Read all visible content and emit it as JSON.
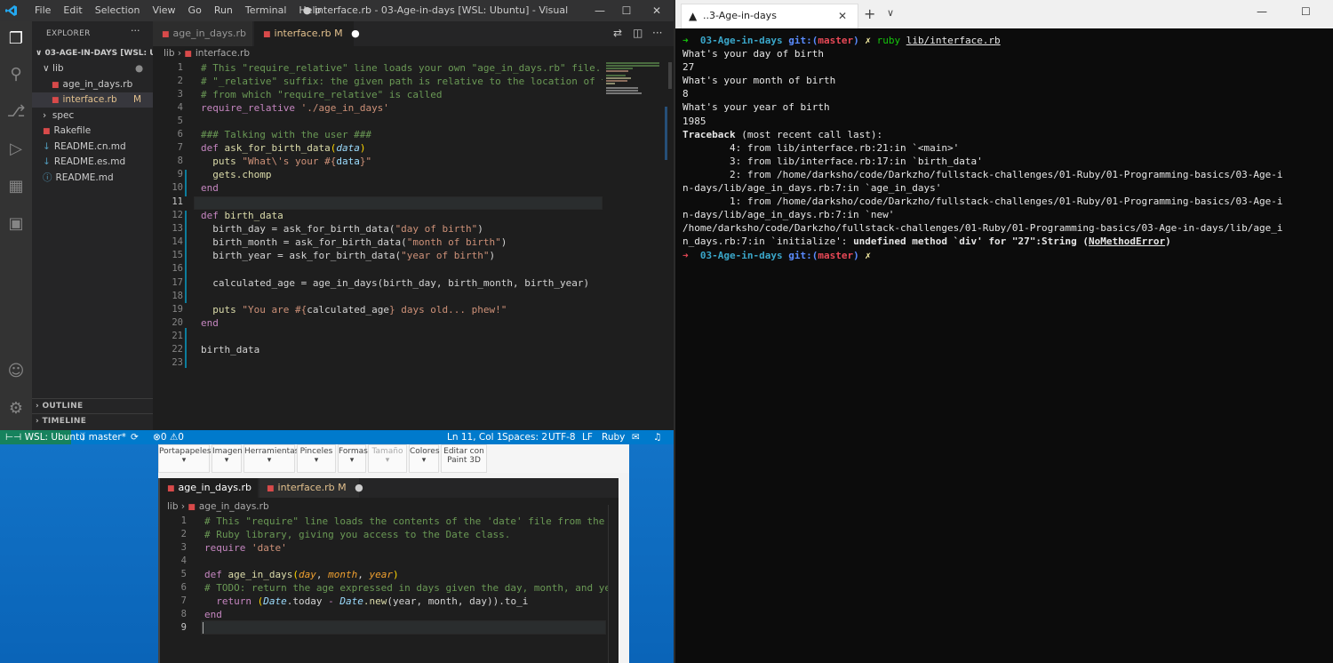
{
  "vscode": {
    "menu": [
      "File",
      "Edit",
      "Selection",
      "View",
      "Go",
      "Run",
      "Terminal",
      "Help"
    ],
    "window_title": "● interface.rb - 03-Age-in-days [WSL: Ubuntu] - Visual Studio Code",
    "explorer": {
      "header": "EXPLORER",
      "root": "03-AGE-IN-DAYS [WSL: UB...",
      "lib": "lib",
      "files_lib": [
        {
          "name": "age_in_days.rb"
        },
        {
          "name": "interface.rb",
          "badge": "M"
        }
      ],
      "spec": "spec",
      "root_files": [
        "Rakefile",
        "README.cn.md",
        "README.es.md",
        "README.md"
      ],
      "outline": "OUTLINE",
      "timeline": "TIMELINE"
    },
    "tabs": [
      {
        "label": "age_in_days.rb"
      },
      {
        "label": "interface.rb",
        "badge": "M"
      }
    ],
    "breadcrumb": {
      "folder": "lib",
      "file": "interface.rb"
    },
    "line_numbers": [
      "1",
      "2",
      "3",
      "4",
      "5",
      "6",
      "7",
      "8",
      "9",
      "10",
      "11",
      "12",
      "13",
      "14",
      "15",
      "16",
      "17",
      "18",
      "19",
      "20",
      "21",
      "22",
      "23"
    ],
    "status": {
      "remote": "WSL: Ubuntu",
      "branch": "master*",
      "problems": "0",
      "warnings": "0",
      "position": "Ln 11, Col 1",
      "spaces": "Spaces: 2",
      "encoding": "UTF-8",
      "eol": "LF",
      "language": "Ruby"
    }
  },
  "code_main": {
    "l1": "# This \"require_relative\" line loads your own \"age_in_days.rb\" file. Notice",
    "l2": "# \"_relative\" suffix: the given path is relative to the location of the fi",
    "l3": "# from which \"require_relative\" is called",
    "l4a": "require_relative",
    "l4b": "'./age_in_days'",
    "l6": "### Talking with the user ###",
    "l7a": "def",
    "l7b": "ask_for_birth_data",
    "l7c": "data",
    "l8a": "puts",
    "l8b": "\"What\\'s your #{",
    "l8c": "data",
    "l8d": "}\"",
    "l9": "gets.chomp",
    "l10": "end",
    "l12a": "def",
    "l12b": "birth_data",
    "l13a": "birth_day = ask_for_birth_data(",
    "l13b": "\"day of birth\"",
    "l14a": "birth_month = ask_for_birth_data(",
    "l14b": "\"month of birth\"",
    "l15a": "birth_year = ask_for_birth_data(",
    "l15b": "\"year of birth\"",
    "l17": "calculated_age = age_in_days(birth_day, birth_month, birth_year)",
    "l19a": "puts",
    "l19b": "\"You are #{",
    "l19c": "calculated_age",
    "l19d": "} days old... phew!\"",
    "l20": "end",
    "l22": "birth_data"
  },
  "paint_toolbar": [
    "Portapapeles",
    "Imagen",
    "Herramientas",
    "Pinceles",
    "Formas",
    "Tamaño",
    "Colores",
    "Editar con Paint 3D"
  ],
  "editor2": {
    "tabs": [
      {
        "label": "age_in_days.rb"
      },
      {
        "label": "interface.rb",
        "badge": "M"
      }
    ],
    "breadcrumb": {
      "folder": "lib",
      "file": "age_in_days.rb"
    },
    "line_numbers": [
      "1",
      "2",
      "3",
      "4",
      "5",
      "6",
      "7",
      "8",
      "9"
    ],
    "l1": "# This \"require\" line loads the contents of the 'date' file from the standa",
    "l2": "# Ruby library, giving you access to the Date class.",
    "l3a": "require",
    "l3b": "'date'",
    "l5a": "def",
    "l5b": "age_in_days",
    "l5c": "day",
    "l5d": "month",
    "l5e": "year",
    "l6": "# TODO: return the age expressed in days given the day, month, and year of",
    "l7a": "return",
    "l7b": "Date",
    "l7c": ".today",
    "l7d": "Date",
    "l7e": ".new",
    "l7f": "(year, month, day)).to_i",
    "l8": "end"
  },
  "terminal": {
    "tab_title": "..3-Age-in-days",
    "prompt_dir": "03-Age-in-days",
    "git": "git:",
    "branch": "master",
    "cmd": "ruby",
    "cmd_arg": "lib/interface.rb",
    "lines": [
      "What's your day of birth",
      "27",
      "What's your month of birth",
      "8",
      "What's your year of birth",
      "1985"
    ],
    "traceback": "Traceback",
    "traceback_rest": " (most recent call last):",
    "trace": [
      "        4: from lib/interface.rb:21:in `<main>'",
      "        3: from lib/interface.rb:17:in `birth_data'",
      "        2: from /home/darksho/code/Darkzho/fullstack-challenges/01-Ruby/01-Programming-basics/03-Age-i",
      "n-days/lib/age_in_days.rb:7:in `age_in_days'",
      "        1: from /home/darksho/code/Darkzho/fullstack-challenges/01-Ruby/01-Programming-basics/03-Age-i",
      "n-days/lib/age_in_days.rb:7:in `new'",
      "/home/darksho/code/Darkzho/fullstack-challenges/01-Ruby/01-Programming-basics/03-Age-in-days/lib/age_i"
    ],
    "error_a": "n_days.rb:7:in `initialize': ",
    "error_b": "undefined method `div' for \"27\":String (",
    "error_c": "NoMethodError",
    "error_d": ")"
  }
}
